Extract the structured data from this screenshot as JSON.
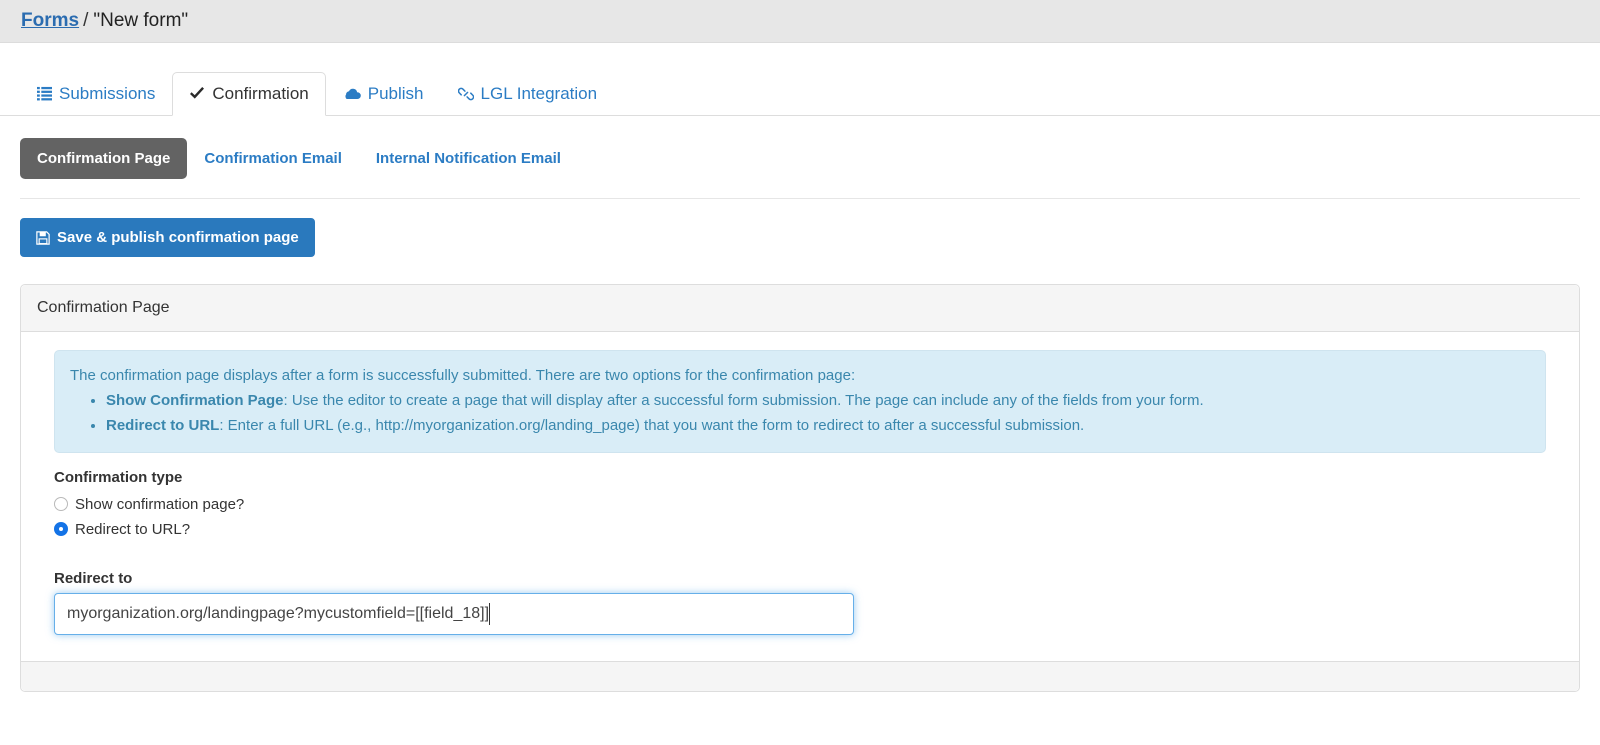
{
  "breadcrumb": {
    "root_label": "Forms",
    "separator": "/",
    "current_label": "\"New form\""
  },
  "tabs": [
    {
      "label": "Submissions",
      "icon": "list-icon",
      "active": false
    },
    {
      "label": "Confirmation",
      "icon": "check-icon",
      "active": true
    },
    {
      "label": "Publish",
      "icon": "cloud-icon",
      "active": false
    },
    {
      "label": "LGL Integration",
      "icon": "link-icon",
      "active": false
    }
  ],
  "subtabs": [
    {
      "label": "Confirmation Page",
      "active": true
    },
    {
      "label": "Confirmation Email",
      "active": false
    },
    {
      "label": "Internal Notification Email",
      "active": false
    }
  ],
  "toolbar": {
    "save_label": "Save & publish confirmation page",
    "save_icon": "floppy-disk-icon"
  },
  "panel": {
    "title": "Confirmation Page",
    "alert": {
      "intro": "The confirmation page displays after a form is successfully submitted. There are two options for the confirmation page:",
      "bullets": [
        {
          "term": "Show Confirmation Page",
          "text": ": Use the editor to create a page that will display after a successful form submission. The page can include any of the fields from your form."
        },
        {
          "term": "Redirect to URL",
          "text": ": Enter a full URL (e.g., http://myorganization.org/landing_page) that you want the form to redirect to after a successful submission."
        }
      ]
    },
    "confirmation_type": {
      "label": "Confirmation type",
      "options": [
        {
          "label": "Show confirmation page?",
          "selected": false
        },
        {
          "label": "Redirect to URL?",
          "selected": true
        }
      ]
    },
    "redirect": {
      "label": "Redirect to",
      "value": "myorganization.org/landingpage?mycustomfield=[[field_18]]",
      "placeholder": ""
    }
  },
  "colors": {
    "link_blue": "#2b7cc4",
    "primary_button": "#2a79bd",
    "active_subtab": "#636363",
    "alert_bg": "#d9edf7",
    "alert_text": "#3a87ad",
    "radio_selected": "#1473e6",
    "header_bar": "#e7e7e7"
  }
}
